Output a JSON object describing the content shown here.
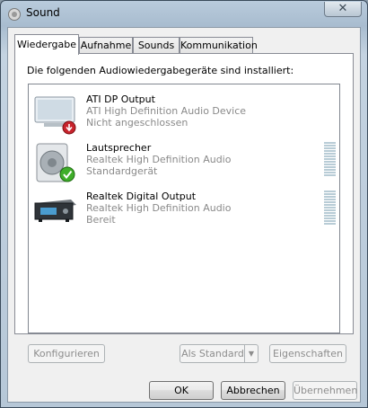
{
  "window": {
    "title": "Sound",
    "close_glyph": "✕"
  },
  "tabs": [
    {
      "label": "Wiedergabe",
      "active": true
    },
    {
      "label": "Aufnahme",
      "active": false
    },
    {
      "label": "Sounds",
      "active": false
    },
    {
      "label": "Kommunikation",
      "active": false
    }
  ],
  "panel": {
    "description": "Die folgenden Audiowiedergabegeräte sind installiert:"
  },
  "devices": [
    {
      "name": "ATI DP Output",
      "driver": "ATI High Definition Audio Device",
      "status": "Nicht angeschlossen",
      "icon": "monitor-disconnected-icon",
      "badge": "red-down-arrow",
      "meter": false
    },
    {
      "name": "Lautsprecher",
      "driver": "Realtek High Definition Audio",
      "status": "Standardgerät",
      "icon": "speaker-default-icon",
      "badge": "green-check",
      "meter": true
    },
    {
      "name": "Realtek Digital Output",
      "driver": "Realtek High Definition Audio",
      "status": "Bereit",
      "icon": "digital-output-device-icon",
      "badge": "",
      "meter": true
    }
  ],
  "buttons": {
    "configure": "Konfigurieren",
    "set_default": "Als Standard",
    "properties": "Eigenschaften",
    "ok": "OK",
    "cancel": "Abbrechen",
    "apply": "Übernehmen"
  },
  "colors": {
    "accent_check": "#3fae2a",
    "badge_red": "#c8232c",
    "meter": "#b8ccd6"
  }
}
